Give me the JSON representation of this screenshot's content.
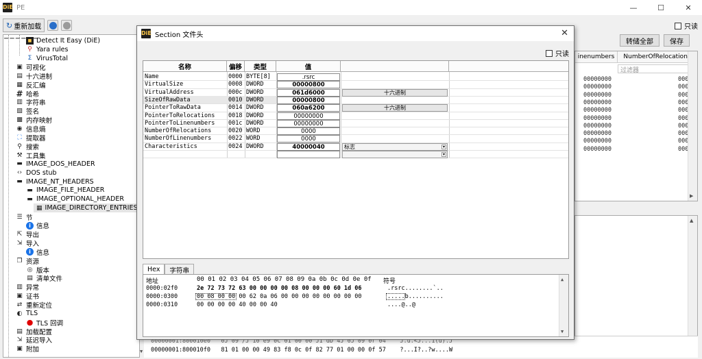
{
  "window": {
    "title": "PE",
    "min": "—",
    "max": "☐",
    "close": "✕"
  },
  "logo_text": "DiE",
  "toolbar": {
    "reload_label": "重新加载"
  },
  "readonly_label": "只读",
  "tree": [
    {
      "label": "Detect It Easy (DiE)",
      "icon": "die-logo-icon",
      "level": 2
    },
    {
      "label": "Yara rules",
      "icon": "yara-icon",
      "level": 2
    },
    {
      "label": "VirusTotal",
      "icon": "virustotal-icon",
      "level": 2
    },
    {
      "label": "可视化",
      "icon": "picture-icon",
      "level": 1
    },
    {
      "label": "十六进制",
      "icon": "hex-icon",
      "level": 1
    },
    {
      "label": "反汇编",
      "icon": "disasm-icon",
      "level": 1
    },
    {
      "label": "哈希",
      "icon": "hash-icon",
      "level": 1
    },
    {
      "label": "字符串",
      "icon": "strings-icon",
      "level": 1
    },
    {
      "label": "签名",
      "icon": "signature-icon",
      "level": 1
    },
    {
      "label": "内存映射",
      "icon": "memory-map-icon",
      "level": 1
    },
    {
      "label": "信息熵",
      "icon": "entropy-icon",
      "level": 1
    },
    {
      "label": "提取器",
      "icon": "extractor-icon",
      "level": 1
    },
    {
      "label": "搜索",
      "icon": "search-icon",
      "level": 1
    },
    {
      "label": "工具集",
      "icon": "tools-icon",
      "level": 1
    },
    {
      "label": "IMAGE_DOS_HEADER",
      "icon": "doc-icon",
      "level": 1
    },
    {
      "label": "DOS stub",
      "icon": "code-icon",
      "level": 1
    },
    {
      "label": "IMAGE_NT_HEADERS",
      "icon": "doc-icon",
      "level": 1
    },
    {
      "label": "IMAGE_FILE_HEADER",
      "icon": "doc-icon",
      "level": 2
    },
    {
      "label": "IMAGE_OPTIONAL_HEADER",
      "icon": "doc-icon",
      "level": 2
    },
    {
      "label": "IMAGE_DIRECTORY_ENTRIES",
      "icon": "table-icon",
      "level": 3
    },
    {
      "label": "节",
      "icon": "sections-icon",
      "level": 1
    },
    {
      "label": "信息",
      "icon": "info-icon",
      "level": 2
    },
    {
      "label": "导出",
      "icon": "export-icon",
      "level": 1
    },
    {
      "label": "导入",
      "icon": "import-icon",
      "level": 1
    },
    {
      "label": "信息",
      "icon": "info-icon",
      "level": 2
    },
    {
      "label": "资源",
      "icon": "resource-icon",
      "level": 1
    },
    {
      "label": "版本",
      "icon": "version-icon",
      "level": 2
    },
    {
      "label": "清单文件",
      "icon": "manifest-icon",
      "level": 2
    },
    {
      "label": "异常",
      "icon": "exception-icon",
      "level": 1
    },
    {
      "label": "证书",
      "icon": "certificate-icon",
      "level": 1
    },
    {
      "label": "重新定位",
      "icon": "relocation-icon",
      "level": 1
    },
    {
      "label": "TLS",
      "icon": "tls-icon",
      "level": 1
    },
    {
      "label": "TLS 回调",
      "icon": "red-dot-icon",
      "level": 2
    },
    {
      "label": "加载配置",
      "icon": "loadconfig-icon",
      "level": 1
    },
    {
      "label": "延迟导入",
      "icon": "delay-import-icon",
      "level": 1
    },
    {
      "label": "附加",
      "icon": "overlay-icon",
      "level": 1
    }
  ],
  "background": {
    "buttons": [
      "转储全部",
      "保存"
    ],
    "headers": [
      "inenumbers",
      "NumberOfRelocations"
    ],
    "filter_placeholder": "过滤器",
    "rows": [
      [
        "00000000",
        "0000"
      ],
      [
        "00000000",
        "0000"
      ],
      [
        "00000000",
        "0000"
      ],
      [
        "00000000",
        "0000"
      ],
      [
        "00000000",
        "0000"
      ],
      [
        "00000000",
        "0000"
      ],
      [
        "00000000",
        "0000"
      ],
      [
        "00000000",
        "0000"
      ],
      [
        "00000000",
        "0000"
      ],
      [
        "00000000",
        "0000"
      ]
    ],
    "bottom_rows": [
      "00000001:800010e0   0J 09 /J 10 e9 0C 01 00 00 J1 dD 4J 0J 09 0r 04    J.u.<J...1(u).J",
      "00000001:800010f0   81 01 00 00 49 83 f8 0c 0f 82 77 01 00 00 0f 57    ?...I?..?w....W"
    ]
  },
  "dialog": {
    "title": "Section 文件头",
    "close": "✕",
    "readonly_label": "只读",
    "headers": [
      "名称",
      "偏移",
      "类型",
      "值"
    ],
    "rows": [
      {
        "name": "Name",
        "offset": "0000",
        "type": "BYTE[8]",
        "value": ".rsrc",
        "bold": false,
        "extra": null
      },
      {
        "name": "VirtualSize",
        "offset": "0008",
        "type": "DWORD",
        "value": "00000800",
        "bold": true,
        "extra": null
      },
      {
        "name": "VirtualAddress",
        "offset": "000c",
        "type": "DWORD",
        "value": "061d6000",
        "bold": true,
        "extra": "hex"
      },
      {
        "name": "SizeOfRawData",
        "offset": "0010",
        "type": "DWORD",
        "value": "00000800",
        "bold": true,
        "extra": null
      },
      {
        "name": "PointerToRawData",
        "offset": "0014",
        "type": "DWORD",
        "value": "060a6200",
        "bold": true,
        "extra": "hex"
      },
      {
        "name": "PointerToRelocations",
        "offset": "0018",
        "type": "DWORD",
        "value": "00000000",
        "bold": false,
        "extra": null
      },
      {
        "name": "PointerToLinenumbers",
        "offset": "001c",
        "type": "DWORD",
        "value": "00000000",
        "bold": false,
        "extra": null
      },
      {
        "name": "NumberOfRelocations",
        "offset": "0020",
        "type": "WORD",
        "value": "0000",
        "bold": false,
        "extra": null
      },
      {
        "name": "NumberOfLinenumbers",
        "offset": "0022",
        "type": "WORD",
        "value": "0000",
        "bold": false,
        "extra": null
      },
      {
        "name": "Characteristics",
        "offset": "0024",
        "type": "DWORD",
        "value": "40000040",
        "bold": true,
        "extra": "combo"
      }
    ],
    "hex_button_label": "十六进制",
    "flags_combo_label": "标志",
    "tabs": [
      "Hex",
      "字符串"
    ],
    "hex": {
      "addr_header": "地址",
      "byte_header": "00 01 02 03 04 05 06 07 08 09 0a 0b 0c 0d 0e 0f",
      "sym_header": "符号",
      "lines": [
        {
          "addr": "0000:02f0",
          "bytes": "2e 72 73 72 63 00 00 00 00 08 00 00 00 60 1d 06",
          "ascii": ".rsrc........`.."
        },
        {
          "addr": "0000:0300",
          "bytes": "00 08 00 00 00 62 0a 06 00 00 00 00 00 00 00 00",
          "ascii": ".....b.........."
        },
        {
          "addr": "0000:0310",
          "bytes": "00 00 00 00 40 00 00 40",
          "ascii": "....@..@"
        }
      ]
    }
  }
}
